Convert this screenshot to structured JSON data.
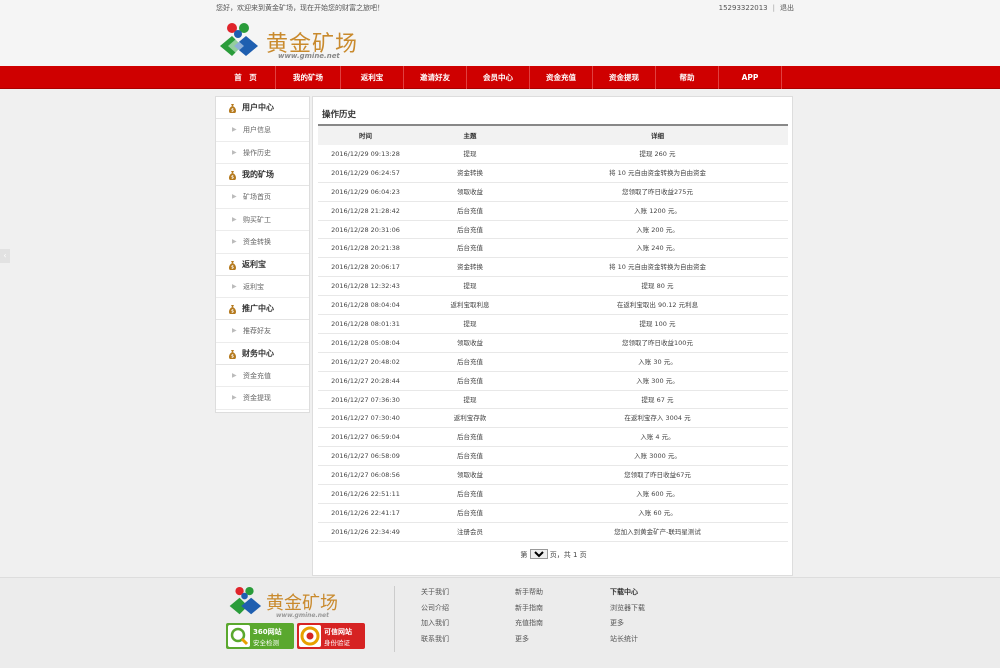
{
  "topbar": {
    "welcome": "您好，欢迎来到黄金矿场，现在开始您的财富之旅吧！",
    "phone": "15293322013",
    "logout": "退出"
  },
  "logo": {
    "cn": "黄金矿场",
    "en": "www.gmine.net"
  },
  "nav": {
    "items": [
      "首　页",
      "我的矿场",
      "返利宝",
      "邀请好友",
      "会员中心",
      "资金充值",
      "资金提现",
      "帮助",
      "APP"
    ]
  },
  "sidebar": {
    "sections": [
      {
        "title": "用户中心",
        "items": [
          "用户信息",
          "操作历史"
        ]
      },
      {
        "title": "我的矿场",
        "items": [
          "矿场首页",
          "购买矿工",
          "资金转换"
        ]
      },
      {
        "title": "返利宝",
        "items": [
          "返利宝"
        ]
      },
      {
        "title": "推广中心",
        "items": [
          "推荐好友"
        ]
      },
      {
        "title": "财务中心",
        "items": [
          "资金充值",
          "资金提现"
        ]
      }
    ]
  },
  "main": {
    "title": "操作历史",
    "columns": [
      "时间",
      "主题",
      "详细"
    ],
    "rows": [
      [
        "2016/12/29 09:13:28",
        "提现",
        "提现 260 元"
      ],
      [
        "2016/12/29 06:24:57",
        "资金转换",
        "将 10 元自由资金转换为自由资金"
      ],
      [
        "2016/12/29 06:04:23",
        "领取收益",
        "您领取了昨日收益275元"
      ],
      [
        "2016/12/28 21:28:42",
        "后台充值",
        "入账 1200 元。"
      ],
      [
        "2016/12/28 20:31:06",
        "后台充值",
        "入账 200 元。"
      ],
      [
        "2016/12/28 20:21:38",
        "后台充值",
        "入账 240 元。"
      ],
      [
        "2016/12/28 20:06:17",
        "资金转换",
        "将 10 元自由资金转换为自由资金"
      ],
      [
        "2016/12/28 12:32:43",
        "提现",
        "提现 80 元"
      ],
      [
        "2016/12/28 08:04:04",
        "返利宝取利息",
        "在返利宝取出 90.12 元利息"
      ],
      [
        "2016/12/28 08:01:31",
        "提现",
        "提现 100 元"
      ],
      [
        "2016/12/28 05:08:04",
        "领取收益",
        "您领取了昨日收益100元"
      ],
      [
        "2016/12/27 20:48:02",
        "后台充值",
        "入账 30 元。"
      ],
      [
        "2016/12/27 20:28:44",
        "后台充值",
        "入账 300 元。"
      ],
      [
        "2016/12/27 07:36:30",
        "提现",
        "提现 67 元"
      ],
      [
        "2016/12/27 07:30:40",
        "返利宝存款",
        "在返利宝存入 3004 元"
      ],
      [
        "2016/12/27 06:59:04",
        "后台充值",
        "入账 4 元。"
      ],
      [
        "2016/12/27 06:58:09",
        "后台充值",
        "入账 3000 元。"
      ],
      [
        "2016/12/27 06:08:56",
        "领取收益",
        "您领取了昨日收益67元"
      ],
      [
        "2016/12/26 22:51:11",
        "后台充值",
        "入账 600 元。"
      ],
      [
        "2016/12/26 22:41:17",
        "后台充值",
        "入账 60 元。"
      ],
      [
        "2016/12/26 22:34:49",
        "注册会员",
        "您加入到黄金矿产-联玛星测试"
      ]
    ],
    "pager": {
      "prefix": "第",
      "page": "1",
      "suffix": "页，共 1 页"
    }
  },
  "footer": {
    "logo_cn": "黄金矿场",
    "logo_en": "www.gmine.net",
    "badge_360": {
      "line1": "360网站",
      "line2": "安全检测"
    },
    "badge_trust": {
      "line1": "可信网站",
      "line2": "身份验证"
    },
    "col1": [
      "关于我们",
      "公司介绍",
      "加入我们",
      "联系我们"
    ],
    "col2": [
      "新手帮助",
      "新手指南",
      "充值指南",
      "更多"
    ],
    "col3": [
      "下载中心",
      "浏览器下载",
      "更多",
      "站长统计"
    ]
  },
  "colors": {
    "nav_red": "#cf0000",
    "gold": "#c98a2d",
    "green_badge": "#5aa82e",
    "red_badge": "#d62323"
  }
}
